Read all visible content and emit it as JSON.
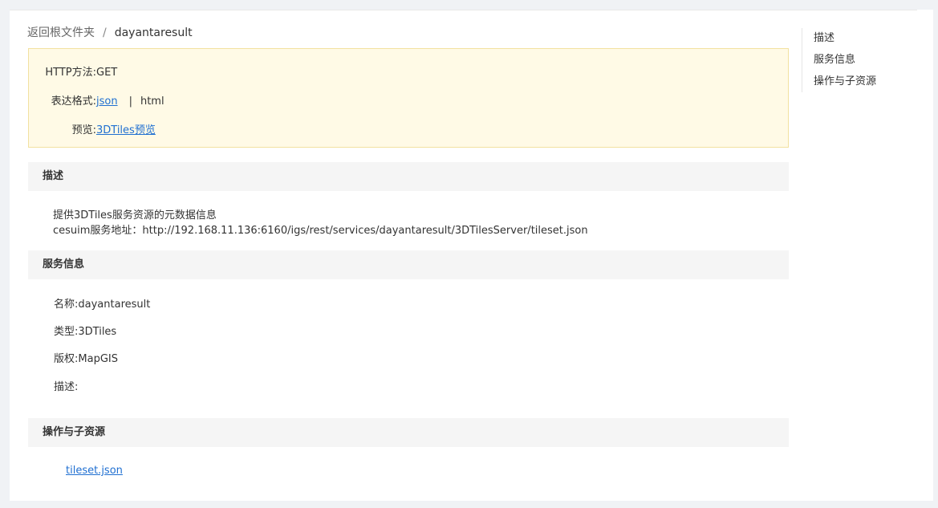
{
  "breadcrumb": {
    "root": "返回根文件夹",
    "separator": "/",
    "current": "dayantaresult"
  },
  "info": {
    "method_label": "HTTP方法:",
    "method_value": "GET",
    "format_label": "表达格式:",
    "format_json": "json",
    "format_separator": "|",
    "format_html": "html",
    "preview_label": "预览:",
    "preview_link": "3DTiles预览"
  },
  "description": {
    "header": "描述",
    "line1": "提供3DTiles服务资源的元数据信息",
    "line2": "cesuim服务地址：http://192.168.11.136:6160/igs/rest/services/dayantaresult/3DTilesServer/tileset.json"
  },
  "service_info": {
    "header": "服务信息",
    "name_label": "名称:",
    "name_value": "dayantaresult",
    "type_label": "类型:",
    "type_value": "3DTiles",
    "copyright_label": "版权:",
    "copyright_value": "MapGIS",
    "desc_label": "描述:",
    "desc_value": ""
  },
  "operations": {
    "header": "操作与子资源",
    "link": "tileset.json"
  },
  "side_nav": {
    "items": [
      "描述",
      "服务信息",
      "操作与子资源"
    ]
  }
}
